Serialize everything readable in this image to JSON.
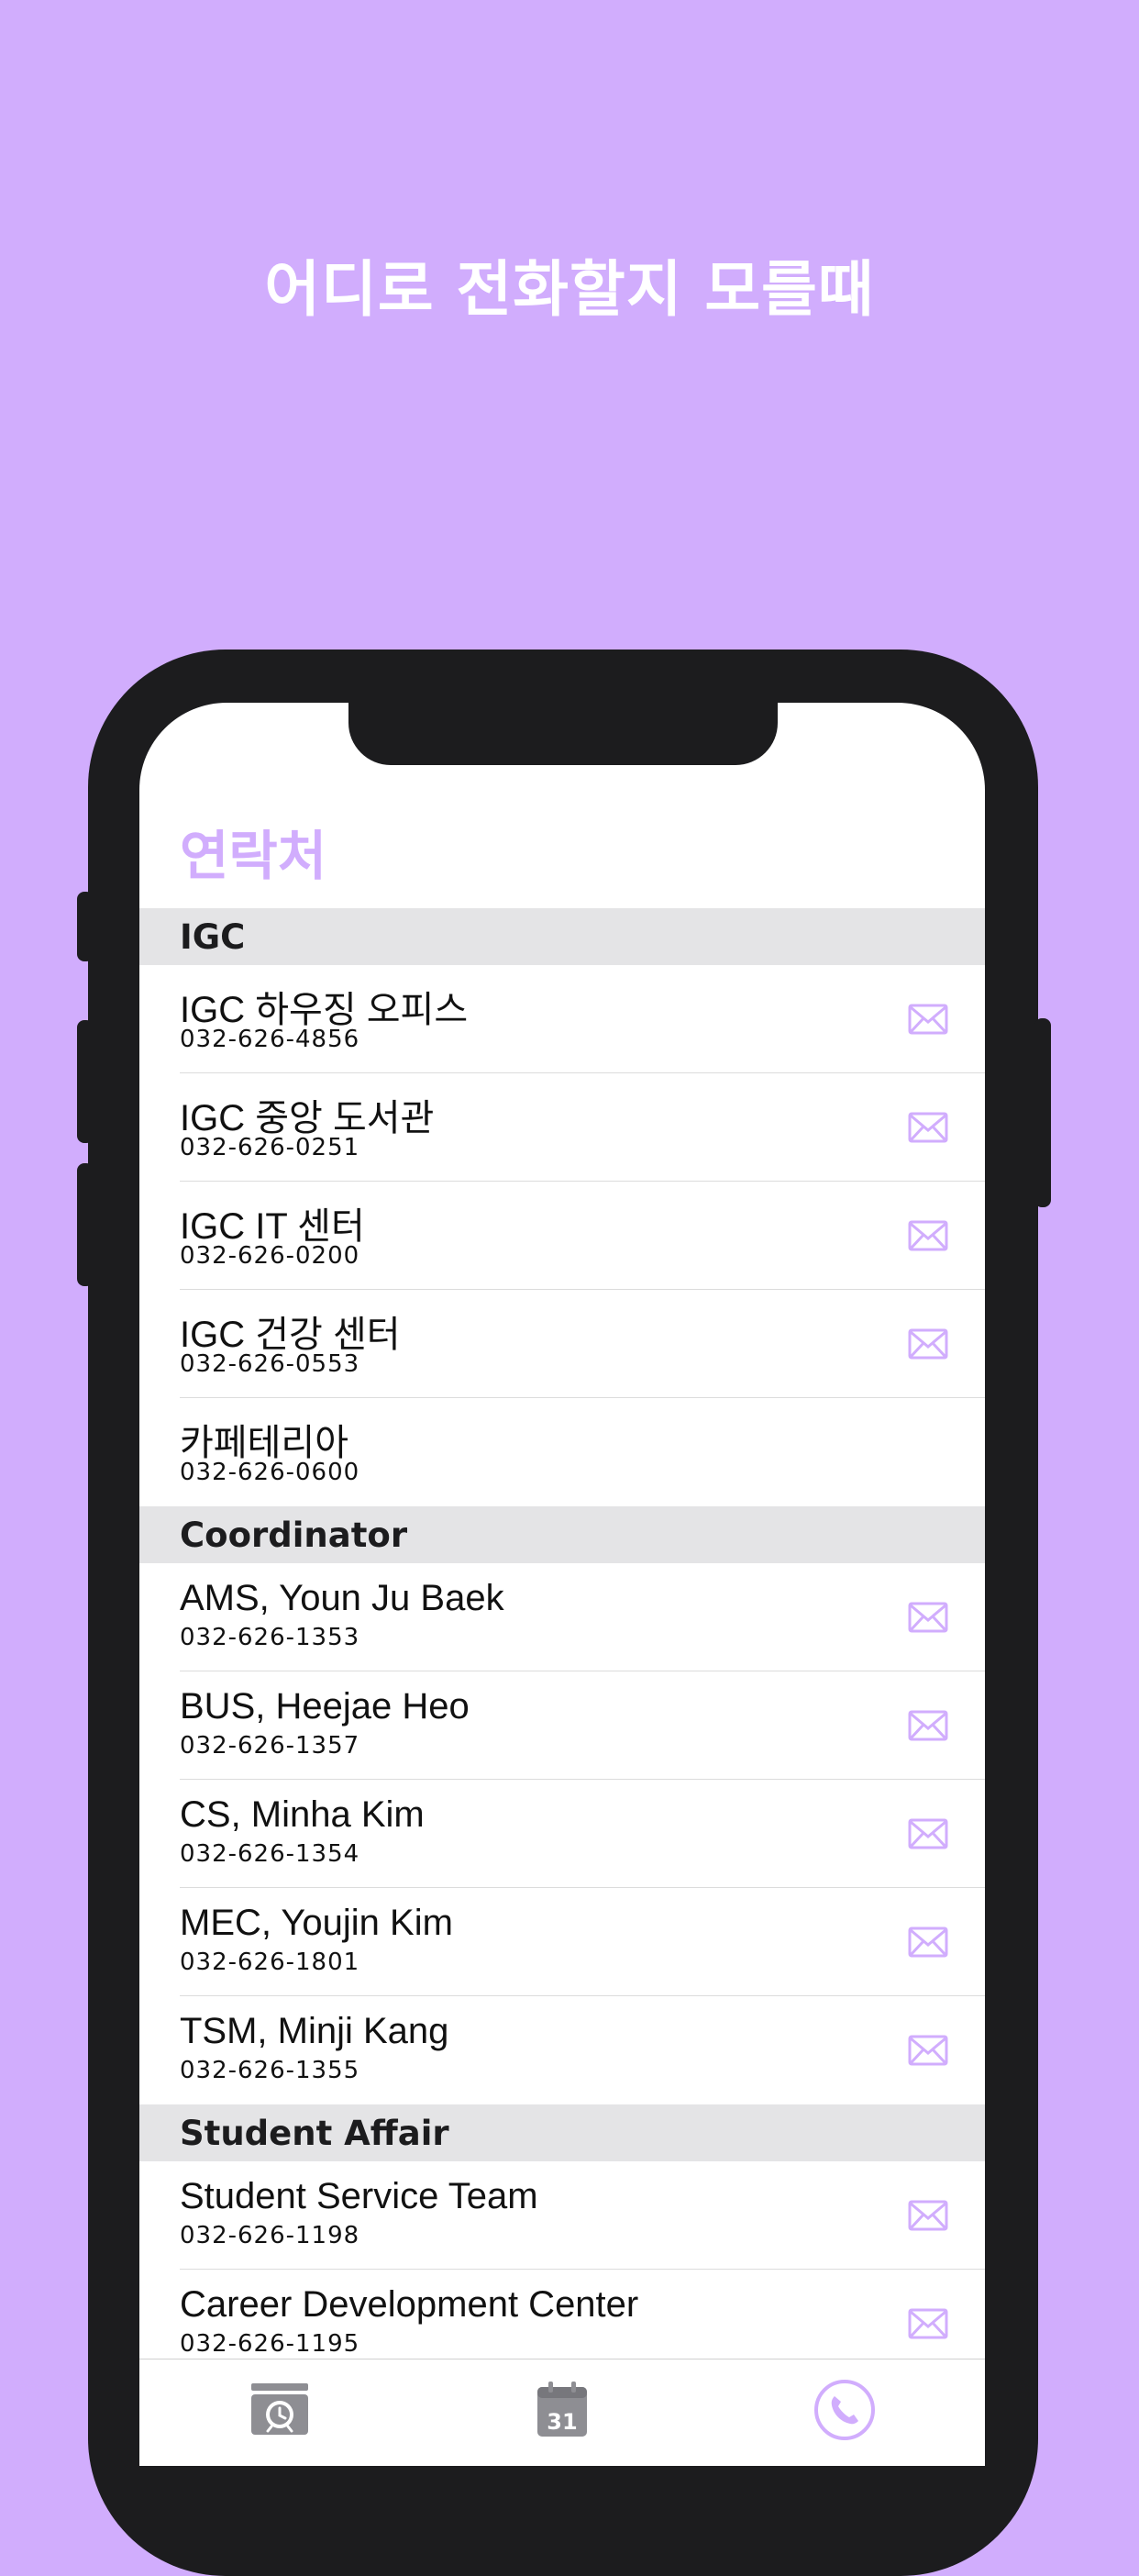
{
  "headline": "어디로 전화할지 모를때",
  "page_title": "연락처",
  "sections": [
    {
      "title": "IGC",
      "contacts": [
        {
          "name": "IGC 하우징 오피스",
          "phone": "032-626-4856",
          "mail": true
        },
        {
          "name": "IGC 중앙 도서관",
          "phone": "032-626-0251",
          "mail": true
        },
        {
          "name": "IGC IT 센터",
          "phone": "032-626-0200",
          "mail": true
        },
        {
          "name": "IGC 건강 센터",
          "phone": "032-626-0553",
          "mail": true
        },
        {
          "name": "카페테리아",
          "phone": "032-626-0600",
          "mail": false
        }
      ]
    },
    {
      "title": "Coordinator",
      "contacts": [
        {
          "name": "AMS, Youn Ju Baek",
          "phone": "032-626-1353",
          "mail": true
        },
        {
          "name": "BUS, Heejae Heo",
          "phone": "032-626-1357",
          "mail": true
        },
        {
          "name": "CS, Minha Kim",
          "phone": "032-626-1354",
          "mail": true
        },
        {
          "name": "MEC, Youjin Kim",
          "phone": "032-626-1801",
          "mail": true
        },
        {
          "name": "TSM, Minji Kang",
          "phone": "032-626-1355",
          "mail": true
        }
      ]
    },
    {
      "title": "Student Affair",
      "contacts": [
        {
          "name": "Student Service Team",
          "phone": "032-626-1198",
          "mail": true
        },
        {
          "name": "Career Development Center",
          "phone": "032-626-1195",
          "mail": true
        }
      ]
    }
  ],
  "tabbar": {
    "items": [
      {
        "icon": "alarm-icon",
        "selected": false
      },
      {
        "icon": "calendar-icon",
        "label": "31",
        "selected": false
      },
      {
        "icon": "phone-icon",
        "selected": true
      }
    ]
  },
  "colors": {
    "background": "#d1adfd",
    "accent": "#d1adfd",
    "section_header_bg": "#e4e4e6",
    "tab_inactive": "#8e8e93",
    "phone_frame": "#1c1c1e"
  }
}
